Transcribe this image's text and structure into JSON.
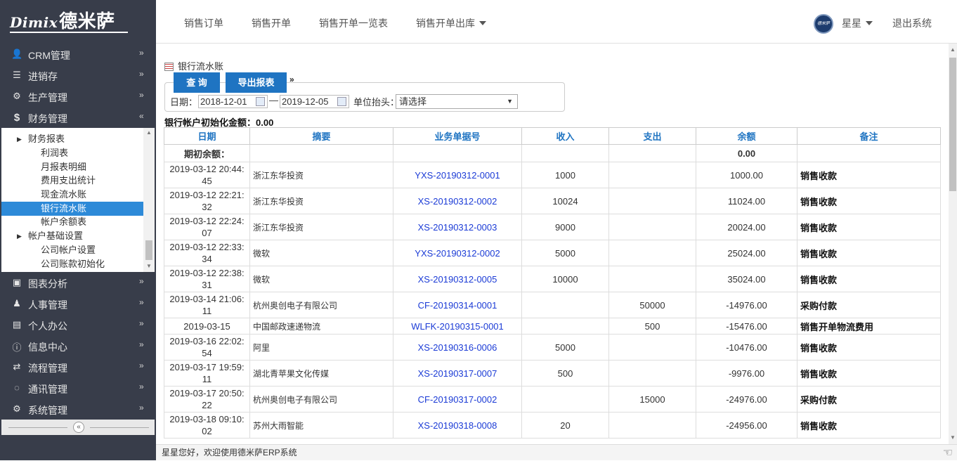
{
  "logo": {
    "latin": "Dimix",
    "cn": "德米萨"
  },
  "topnav": {
    "items": [
      "销售订单",
      "销售开单",
      "销售开单一览表",
      "销售开单出库"
    ],
    "avatar_text": "德米萨",
    "user": "星星",
    "logout": "退出系统"
  },
  "sidebar": {
    "menus": [
      {
        "label": "CRM管理",
        "icon": "user-icon"
      },
      {
        "label": "进销存",
        "icon": "list-icon"
      },
      {
        "label": "生产管理",
        "icon": "cogs-icon"
      },
      {
        "label": "财务管理",
        "icon": "dollar-icon"
      },
      {
        "label": "图表分析",
        "icon": "picture-icon"
      },
      {
        "label": "人事管理",
        "icon": "people-icon"
      },
      {
        "label": "个人办公",
        "icon": "briefcase-icon"
      },
      {
        "label": "信息中心",
        "icon": "info-icon"
      },
      {
        "label": "流程管理",
        "icon": "exchange-icon"
      },
      {
        "label": "通讯管理",
        "icon": "comment-icon"
      },
      {
        "label": "系统管理",
        "icon": "gear-icon"
      }
    ],
    "submenu": [
      {
        "label": "财务报表",
        "level": 1
      },
      {
        "label": "利润表",
        "level": 2
      },
      {
        "label": "月报表明细",
        "level": 2
      },
      {
        "label": "费用支出统计",
        "level": 2
      },
      {
        "label": "现金流水账",
        "level": 2
      },
      {
        "label": "银行流水账",
        "level": 2,
        "active": true
      },
      {
        "label": "帐户余额表",
        "level": 2
      },
      {
        "label": "帐户基础设置",
        "level": 1
      },
      {
        "label": "公司帐户设置",
        "level": 2
      },
      {
        "label": "公司账款初始化",
        "level": 2
      }
    ]
  },
  "page": {
    "title": "银行流水账",
    "query_btn": "查 询",
    "export_btn": "导出报表",
    "date_label": "日期：",
    "date_from": "2018-12-01",
    "date_sep": "—",
    "date_to": "2019-12-05",
    "unit_label": "单位抬头：",
    "unit_select": "请选择",
    "init_balance_label": "银行帐户初始化金额：",
    "init_balance_value": "0.00"
  },
  "table": {
    "headers": [
      "日期",
      "摘要",
      "业务单据号",
      "收入",
      "支出",
      "余额",
      "备注"
    ],
    "opening": {
      "label": "期初余额：",
      "balance": "0.00"
    },
    "rows": [
      {
        "date": "2019-03-12 20:44:45",
        "summary": "浙江东华投资",
        "docno": "YXS-20190312-0001",
        "income": "1000",
        "expense": "",
        "balance": "1000.00",
        "note": "销售收款"
      },
      {
        "date": "2019-03-12 22:21:32",
        "summary": "浙江东华投资",
        "docno": "XS-20190312-0002",
        "income": "10024",
        "expense": "",
        "balance": "11024.00",
        "note": "销售收款"
      },
      {
        "date": "2019-03-12 22:24:07",
        "summary": "浙江东华投资",
        "docno": "XS-20190312-0003",
        "income": "9000",
        "expense": "",
        "balance": "20024.00",
        "note": "销售收款"
      },
      {
        "date": "2019-03-12 22:33:34",
        "summary": "微软",
        "docno": "YXS-20190312-0002",
        "income": "5000",
        "expense": "",
        "balance": "25024.00",
        "note": "销售收款"
      },
      {
        "date": "2019-03-12 22:38:31",
        "summary": "微软",
        "docno": "XS-20190312-0005",
        "income": "10000",
        "expense": "",
        "balance": "35024.00",
        "note": "销售收款"
      },
      {
        "date": "2019-03-14 21:06:11",
        "summary": "杭州奥创电子有限公司",
        "docno": "CF-20190314-0001",
        "income": "",
        "expense": "50000",
        "balance": "-14976.00",
        "note": "采购付款"
      },
      {
        "date": "2019-03-15",
        "summary": "中国邮政速递物流",
        "docno": "WLFK-20190315-0001",
        "income": "",
        "expense": "500",
        "balance": "-15476.00",
        "note": "销售开单物流费用"
      },
      {
        "date": "2019-03-16 22:02:54",
        "summary": "阿里",
        "docno": "XS-20190316-0006",
        "income": "5000",
        "expense": "",
        "balance": "-10476.00",
        "note": "销售收款"
      },
      {
        "date": "2019-03-17 19:59:11",
        "summary": "湖北青苹果文化传媒",
        "docno": "XS-20190317-0007",
        "income": "500",
        "expense": "",
        "balance": "-9976.00",
        "note": "销售收款"
      },
      {
        "date": "2019-03-17 20:50:22",
        "summary": "杭州奥创电子有限公司",
        "docno": "CF-20190317-0002",
        "income": "",
        "expense": "15000",
        "balance": "-24976.00",
        "note": "采购付款"
      },
      {
        "date": "2019-03-18 09:10:02",
        "summary": "苏州大雨智能",
        "docno": "XS-20190318-0008",
        "income": "20",
        "expense": "",
        "balance": "-24956.00",
        "note": "销售收款"
      }
    ]
  },
  "status": {
    "text": "星星您好，欢迎使用德米萨ERP系统"
  }
}
